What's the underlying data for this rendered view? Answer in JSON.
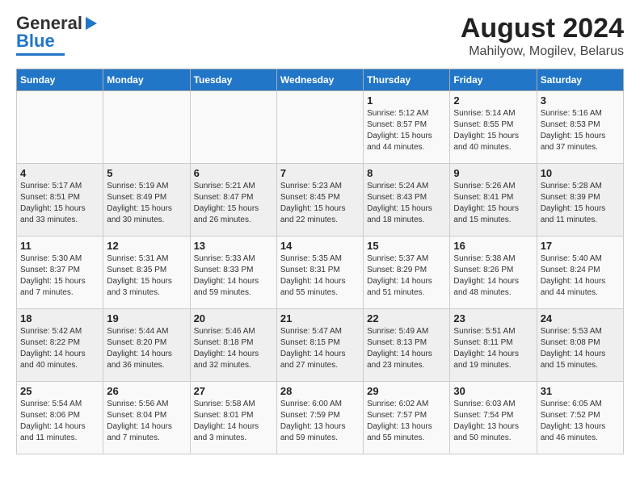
{
  "header": {
    "logo_general": "General",
    "logo_blue": "Blue",
    "main_title": "August 2024",
    "sub_title": "Mahilyow, Mogilev, Belarus"
  },
  "days_of_week": [
    "Sunday",
    "Monday",
    "Tuesday",
    "Wednesday",
    "Thursday",
    "Friday",
    "Saturday"
  ],
  "weeks": [
    [
      {
        "day": "",
        "info": ""
      },
      {
        "day": "",
        "info": ""
      },
      {
        "day": "",
        "info": ""
      },
      {
        "day": "",
        "info": ""
      },
      {
        "day": "1",
        "info": "Sunrise: 5:12 AM\nSunset: 8:57 PM\nDaylight: 15 hours\nand 44 minutes."
      },
      {
        "day": "2",
        "info": "Sunrise: 5:14 AM\nSunset: 8:55 PM\nDaylight: 15 hours\nand 40 minutes."
      },
      {
        "day": "3",
        "info": "Sunrise: 5:16 AM\nSunset: 8:53 PM\nDaylight: 15 hours\nand 37 minutes."
      }
    ],
    [
      {
        "day": "4",
        "info": "Sunrise: 5:17 AM\nSunset: 8:51 PM\nDaylight: 15 hours\nand 33 minutes."
      },
      {
        "day": "5",
        "info": "Sunrise: 5:19 AM\nSunset: 8:49 PM\nDaylight: 15 hours\nand 30 minutes."
      },
      {
        "day": "6",
        "info": "Sunrise: 5:21 AM\nSunset: 8:47 PM\nDaylight: 15 hours\nand 26 minutes."
      },
      {
        "day": "7",
        "info": "Sunrise: 5:23 AM\nSunset: 8:45 PM\nDaylight: 15 hours\nand 22 minutes."
      },
      {
        "day": "8",
        "info": "Sunrise: 5:24 AM\nSunset: 8:43 PM\nDaylight: 15 hours\nand 18 minutes."
      },
      {
        "day": "9",
        "info": "Sunrise: 5:26 AM\nSunset: 8:41 PM\nDaylight: 15 hours\nand 15 minutes."
      },
      {
        "day": "10",
        "info": "Sunrise: 5:28 AM\nSunset: 8:39 PM\nDaylight: 15 hours\nand 11 minutes."
      }
    ],
    [
      {
        "day": "11",
        "info": "Sunrise: 5:30 AM\nSunset: 8:37 PM\nDaylight: 15 hours\nand 7 minutes."
      },
      {
        "day": "12",
        "info": "Sunrise: 5:31 AM\nSunset: 8:35 PM\nDaylight: 15 hours\nand 3 minutes."
      },
      {
        "day": "13",
        "info": "Sunrise: 5:33 AM\nSunset: 8:33 PM\nDaylight: 14 hours\nand 59 minutes."
      },
      {
        "day": "14",
        "info": "Sunrise: 5:35 AM\nSunset: 8:31 PM\nDaylight: 14 hours\nand 55 minutes."
      },
      {
        "day": "15",
        "info": "Sunrise: 5:37 AM\nSunset: 8:29 PM\nDaylight: 14 hours\nand 51 minutes."
      },
      {
        "day": "16",
        "info": "Sunrise: 5:38 AM\nSunset: 8:26 PM\nDaylight: 14 hours\nand 48 minutes."
      },
      {
        "day": "17",
        "info": "Sunrise: 5:40 AM\nSunset: 8:24 PM\nDaylight: 14 hours\nand 44 minutes."
      }
    ],
    [
      {
        "day": "18",
        "info": "Sunrise: 5:42 AM\nSunset: 8:22 PM\nDaylight: 14 hours\nand 40 minutes."
      },
      {
        "day": "19",
        "info": "Sunrise: 5:44 AM\nSunset: 8:20 PM\nDaylight: 14 hours\nand 36 minutes."
      },
      {
        "day": "20",
        "info": "Sunrise: 5:46 AM\nSunset: 8:18 PM\nDaylight: 14 hours\nand 32 minutes."
      },
      {
        "day": "21",
        "info": "Sunrise: 5:47 AM\nSunset: 8:15 PM\nDaylight: 14 hours\nand 27 minutes."
      },
      {
        "day": "22",
        "info": "Sunrise: 5:49 AM\nSunset: 8:13 PM\nDaylight: 14 hours\nand 23 minutes."
      },
      {
        "day": "23",
        "info": "Sunrise: 5:51 AM\nSunset: 8:11 PM\nDaylight: 14 hours\nand 19 minutes."
      },
      {
        "day": "24",
        "info": "Sunrise: 5:53 AM\nSunset: 8:08 PM\nDaylight: 14 hours\nand 15 minutes."
      }
    ],
    [
      {
        "day": "25",
        "info": "Sunrise: 5:54 AM\nSunset: 8:06 PM\nDaylight: 14 hours\nand 11 minutes."
      },
      {
        "day": "26",
        "info": "Sunrise: 5:56 AM\nSunset: 8:04 PM\nDaylight: 14 hours\nand 7 minutes."
      },
      {
        "day": "27",
        "info": "Sunrise: 5:58 AM\nSunset: 8:01 PM\nDaylight: 14 hours\nand 3 minutes."
      },
      {
        "day": "28",
        "info": "Sunrise: 6:00 AM\nSunset: 7:59 PM\nDaylight: 13 hours\nand 59 minutes."
      },
      {
        "day": "29",
        "info": "Sunrise: 6:02 AM\nSunset: 7:57 PM\nDaylight: 13 hours\nand 55 minutes."
      },
      {
        "day": "30",
        "info": "Sunrise: 6:03 AM\nSunset: 7:54 PM\nDaylight: 13 hours\nand 50 minutes."
      },
      {
        "day": "31",
        "info": "Sunrise: 6:05 AM\nSunset: 7:52 PM\nDaylight: 13 hours\nand 46 minutes."
      }
    ]
  ]
}
